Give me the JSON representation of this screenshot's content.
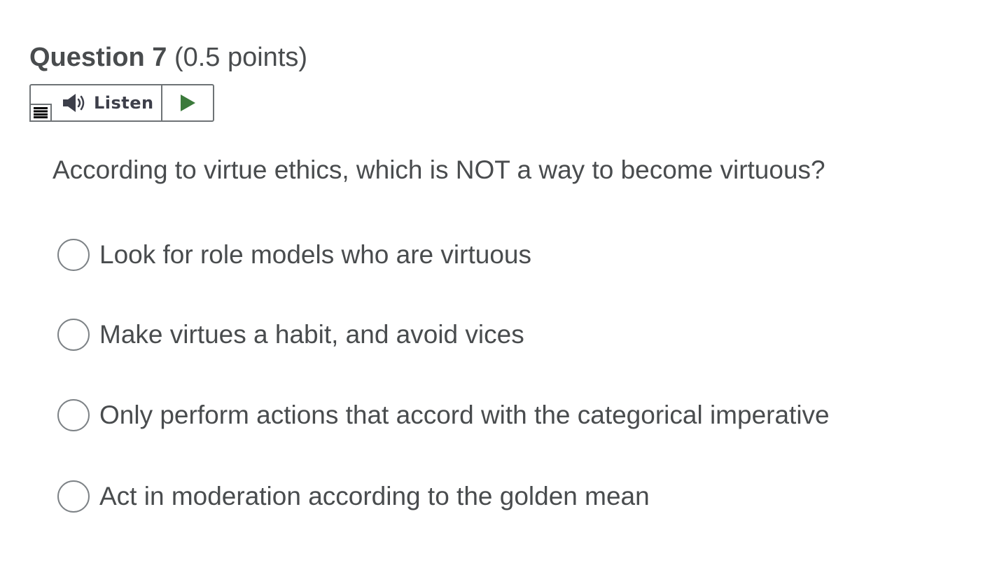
{
  "question": {
    "title": "Question 7",
    "points": "(0.5 points)",
    "text": "According to virtue ethics, which is NOT a way to become virtuous?"
  },
  "listen_widget": {
    "label": "Listen",
    "icons": {
      "menu": "menu-lines-icon",
      "speaker": "speaker-icon",
      "play": "play-icon"
    },
    "colors": {
      "play": "#3b7a3b",
      "speaker": "#3d3f4a"
    }
  },
  "choices": [
    {
      "label": "Look for role models who are virtuous",
      "selected": false
    },
    {
      "label": "Make virtues a habit, and avoid vices",
      "selected": false
    },
    {
      "label": "Only perform actions that accord with the categorical imperative",
      "selected": false
    },
    {
      "label": "Act in moderation according to the golden mean",
      "selected": false
    }
  ]
}
